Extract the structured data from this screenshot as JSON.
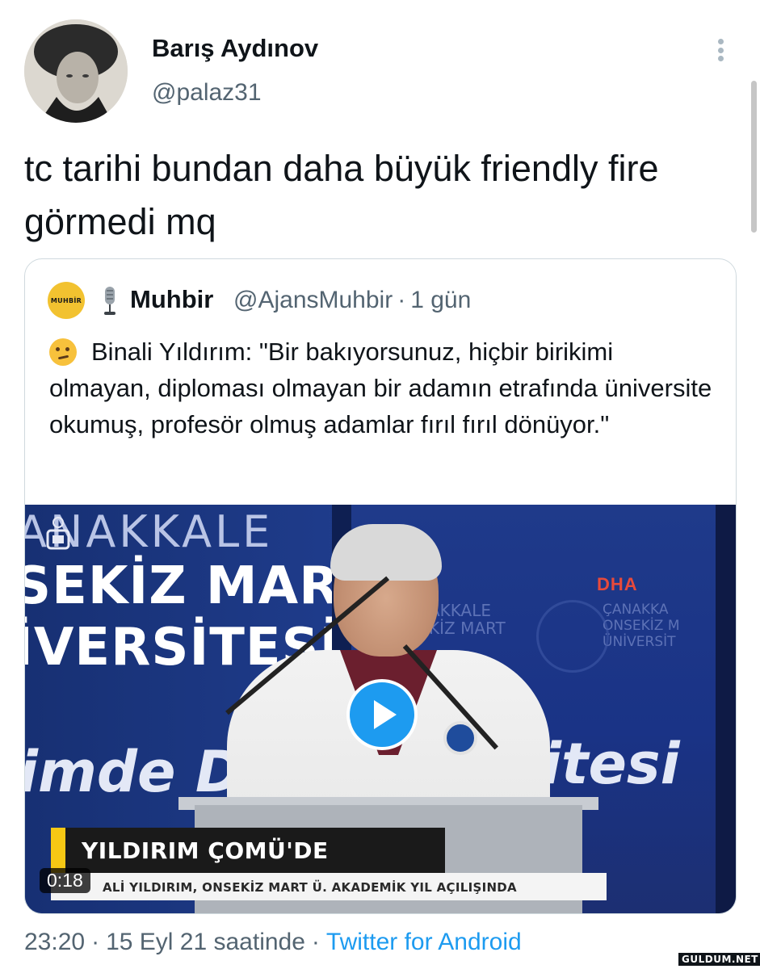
{
  "author": {
    "name": "Barış Aydınov",
    "handle": "@palaz31"
  },
  "tweet": {
    "text": "tc tarihi bundan daha büyük friendly fire görmedi mq"
  },
  "quoted": {
    "avatar_text": "MUHBİR",
    "name": "Muhbir",
    "handle": "@AjansMuhbir",
    "separator": "·",
    "time": "1 gün",
    "text": "Binali Yıldırım: \"Bir bakıyorsunuz, hiçbir birikimi olmayan, diploması olmayan bir adamın etrafında üniversite okumuş, profesör olmuş adamlar fırıl fırıl dönüyor.\"",
    "video": {
      "duration": "0:18",
      "bg_top": "ANAKKALE",
      "bg_line2": "SEKİZ MART",
      "bg_line3": "İVERSİTESİ",
      "bg_bottom_left": "imde D",
      "bg_bottom_right": "itesi",
      "bg_small_center": "AKKALE\nKİZ MART",
      "bg_small_right": "ÇANAKKA\nONSEKİZ M\nÜNİVERSİT",
      "channel_logo": "DHA",
      "caption_title": "YILDIRIM ÇOMÜ'DE",
      "ticker": "ALİ YILDIRIM, ONSEKİZ MART Ü. AKADEMİK YIL AÇILIŞINDA"
    }
  },
  "footer": {
    "time": "23:20",
    "separator": "·",
    "date": "15 Eyl 21 saatinde",
    "source": "Twitter for Android"
  },
  "watermark": "GULDUM.NET",
  "colors": {
    "accent": "#1d9bf0",
    "secondary_text": "#536471",
    "text": "#0f1419",
    "border": "#cfd9de"
  },
  "icons": [
    "more-vertical-icon",
    "microphone-icon",
    "thinking-face-icon",
    "play-icon",
    "tv-icon"
  ]
}
